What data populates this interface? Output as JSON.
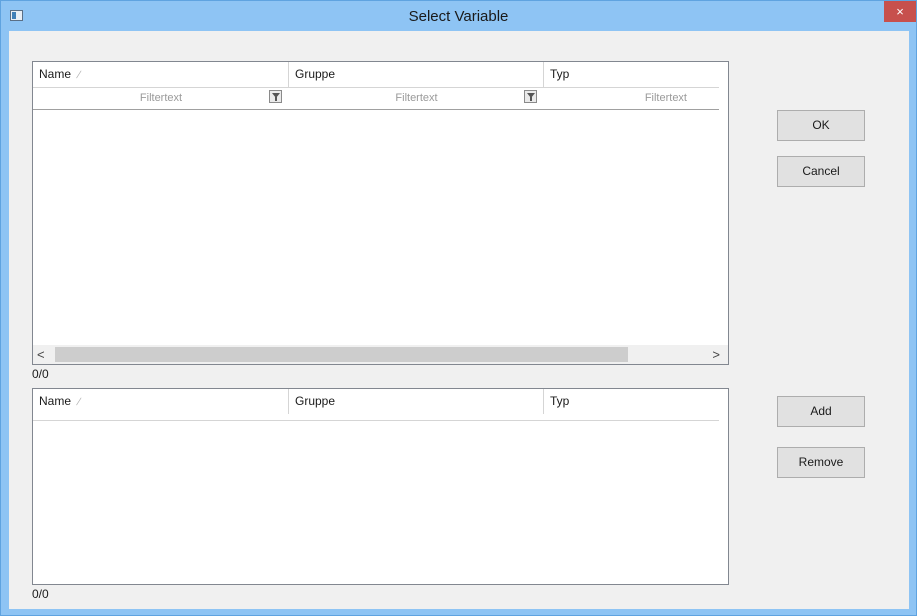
{
  "window": {
    "title": "Select Variable",
    "close_glyph": "×"
  },
  "grid_top": {
    "columns": [
      "Name",
      "Gruppe",
      "Typ"
    ],
    "filter_placeholders": [
      "Filtertext",
      "Filtertext",
      "Filtertext"
    ],
    "scroll_left": "<",
    "scroll_right": ">",
    "count": "0/0"
  },
  "grid_bottom": {
    "columns": [
      "Name",
      "Gruppe",
      "Typ"
    ],
    "count": "0/0"
  },
  "buttons": {
    "ok": "OK",
    "cancel": "Cancel",
    "add": "Add",
    "remove": "Remove"
  },
  "colors": {
    "titlebar": "#8ec4f4",
    "close": "#c7504d",
    "client": "#f0f0f0"
  },
  "icons": {
    "app": "window-app-icon",
    "sort": "sort-indicator-icon",
    "filter": "filter-icon"
  }
}
